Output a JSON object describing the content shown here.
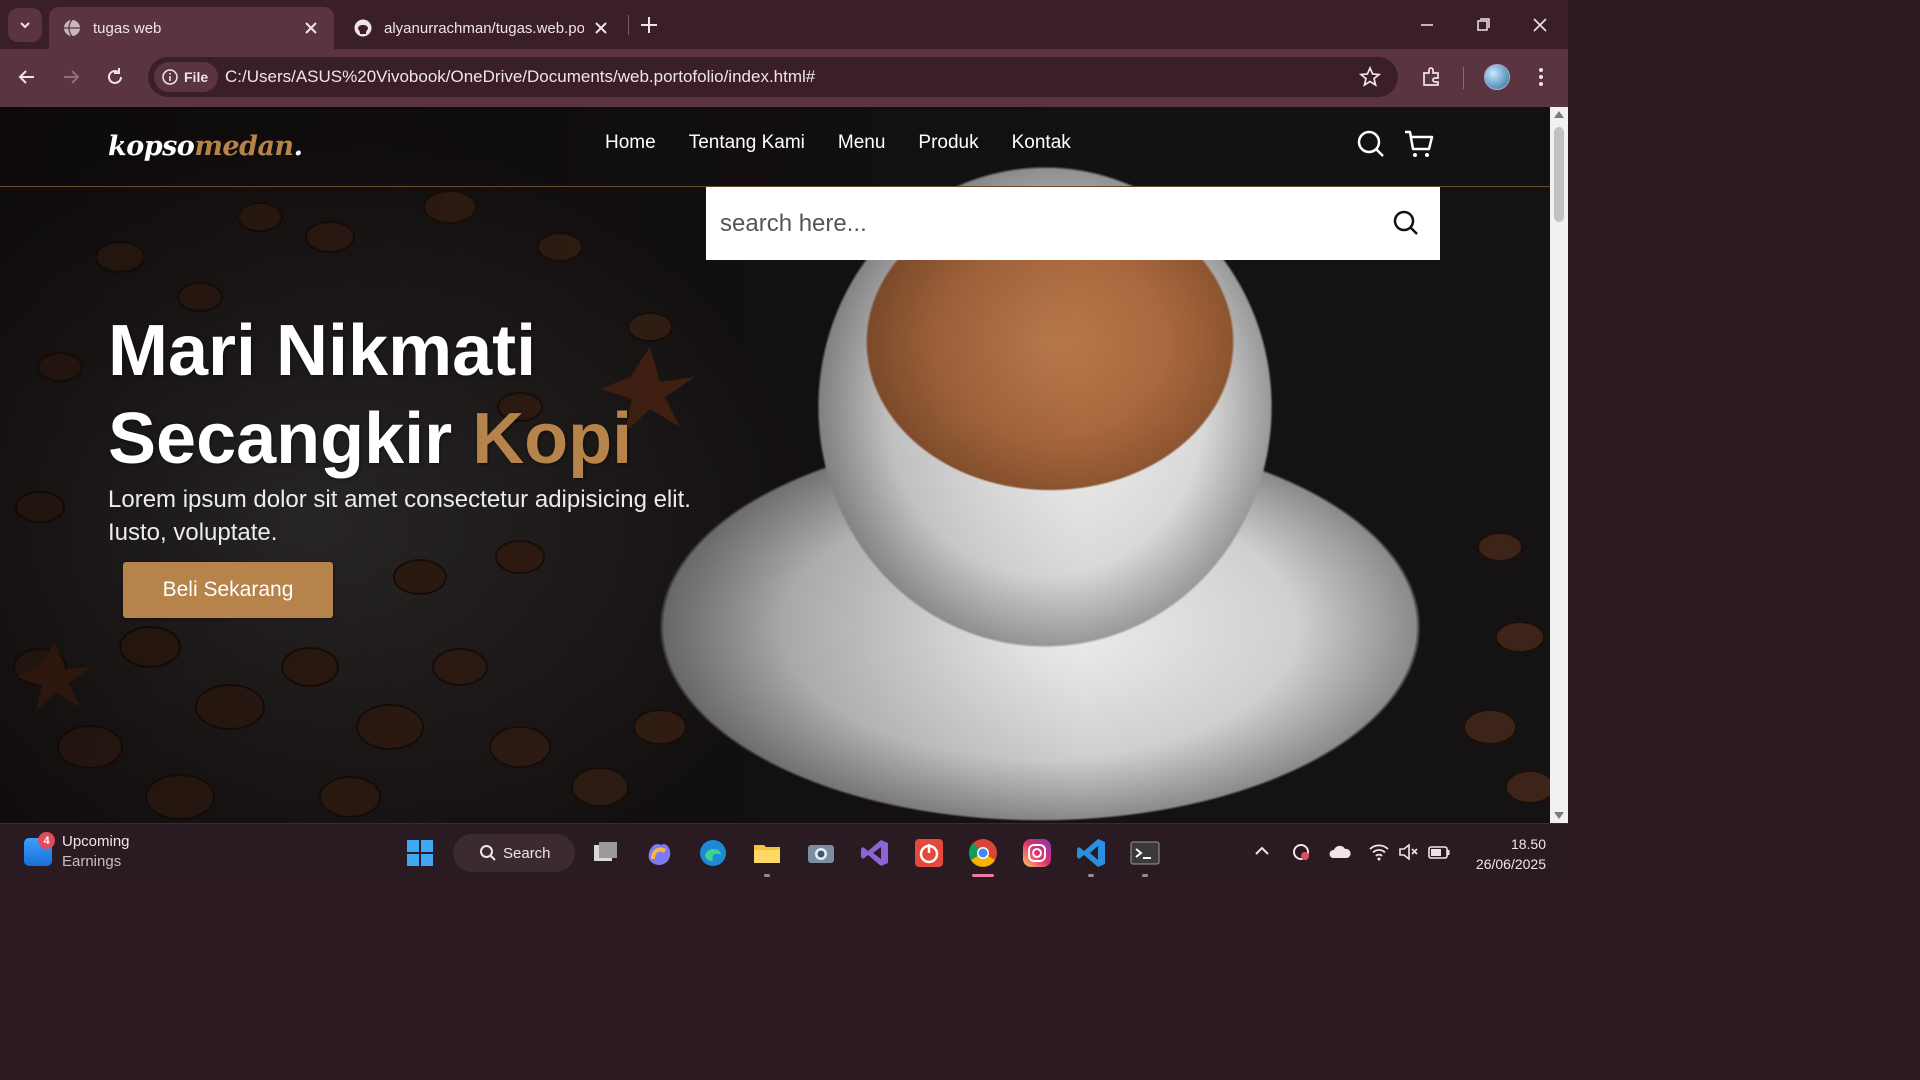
{
  "browser": {
    "tabs": [
      {
        "label": "tugas web",
        "active": true
      },
      {
        "label": "alyanurrachman/tugas.web.port",
        "active": false
      }
    ],
    "address": {
      "chip_label": "File",
      "url": "C:/Users/ASUS%20Vivobook/OneDrive/Documents/web.portofolio/index.html#"
    }
  },
  "page": {
    "logo": {
      "part1": "kopso",
      "part2": "medan",
      "dot": "."
    },
    "nav": [
      "Home",
      "Tentang Kami",
      "Menu",
      "Produk",
      "Kontak"
    ],
    "search": {
      "placeholder": "search here..."
    },
    "hero": {
      "title_line1": "Mari Nikmati",
      "title_line2_a": "Secangkir ",
      "title_line2_b": "Kopi",
      "text": "Lorem ipsum dolor sit amet consectetur adipisicing elit. Iusto, voluptate.",
      "cta": "Beli Sekarang"
    },
    "colors": {
      "accent": "#b6834b",
      "nav_text": "#ffffff"
    }
  },
  "taskbar": {
    "widget": {
      "badge": "4",
      "title": "Upcoming",
      "subtitle": "Earnings"
    },
    "search_label": "Search",
    "clock": {
      "time": "18.50",
      "date": "26/06/2025"
    }
  }
}
